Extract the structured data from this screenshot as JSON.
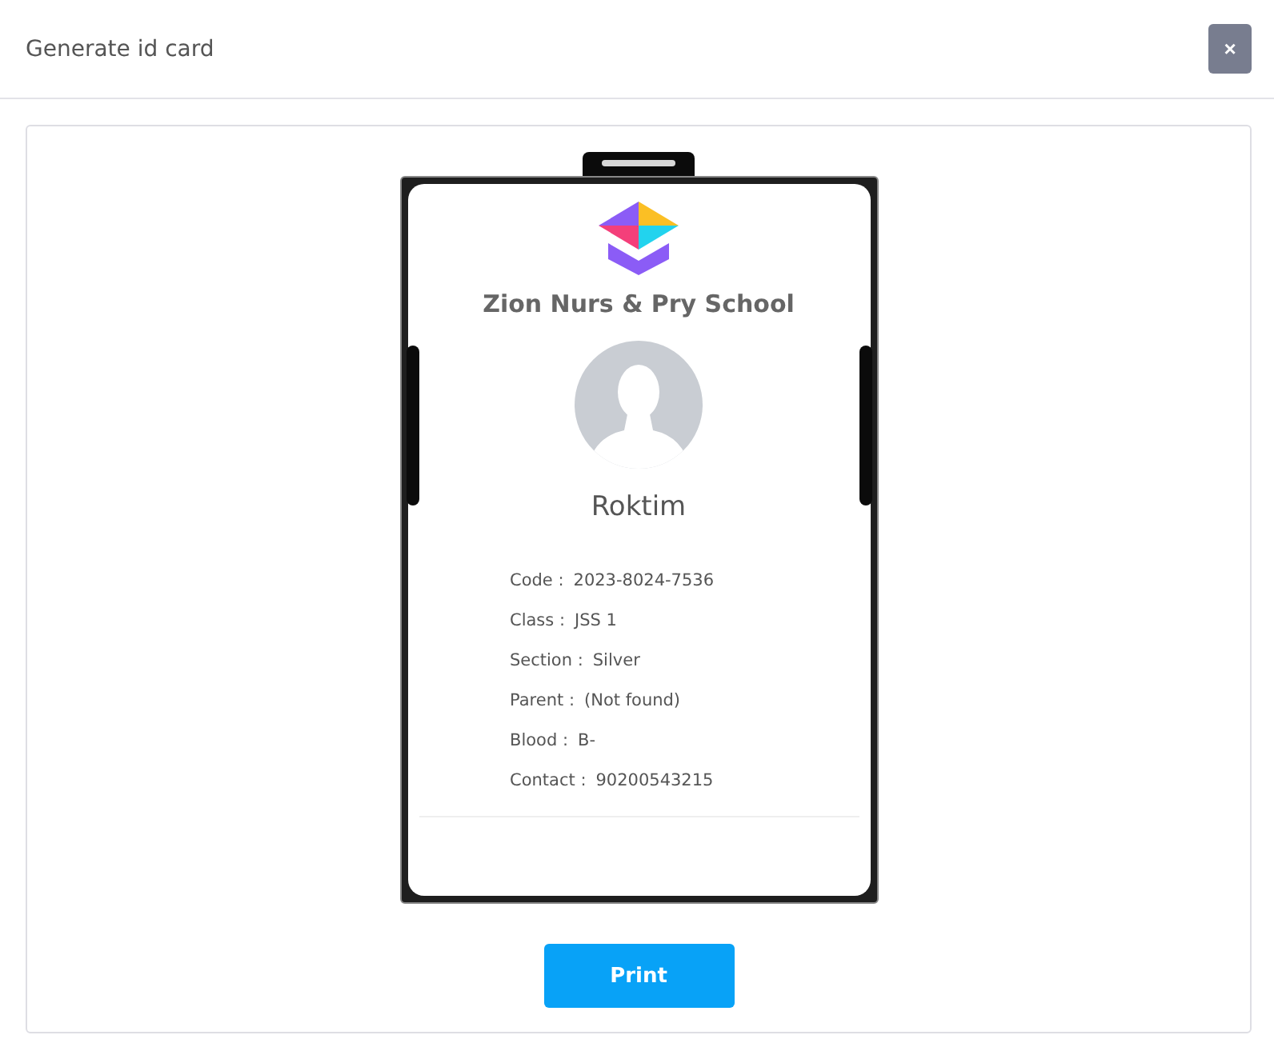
{
  "dialog": {
    "title": "Generate id card",
    "close_label": "×"
  },
  "card": {
    "school": "Zion Nurs & Pry School",
    "name": "Roktim",
    "fields": [
      {
        "label": "Code :",
        "value": "2023-8024-7536"
      },
      {
        "label": "Class :",
        "value": "JSS 1"
      },
      {
        "label": "Section :",
        "value": "Silver"
      },
      {
        "label": "Parent :",
        "value": "(Not found)"
      },
      {
        "label": "Blood :",
        "value": "B-"
      },
      {
        "label": "Contact :",
        "value": "90200543215"
      }
    ]
  },
  "print_button": "Print"
}
